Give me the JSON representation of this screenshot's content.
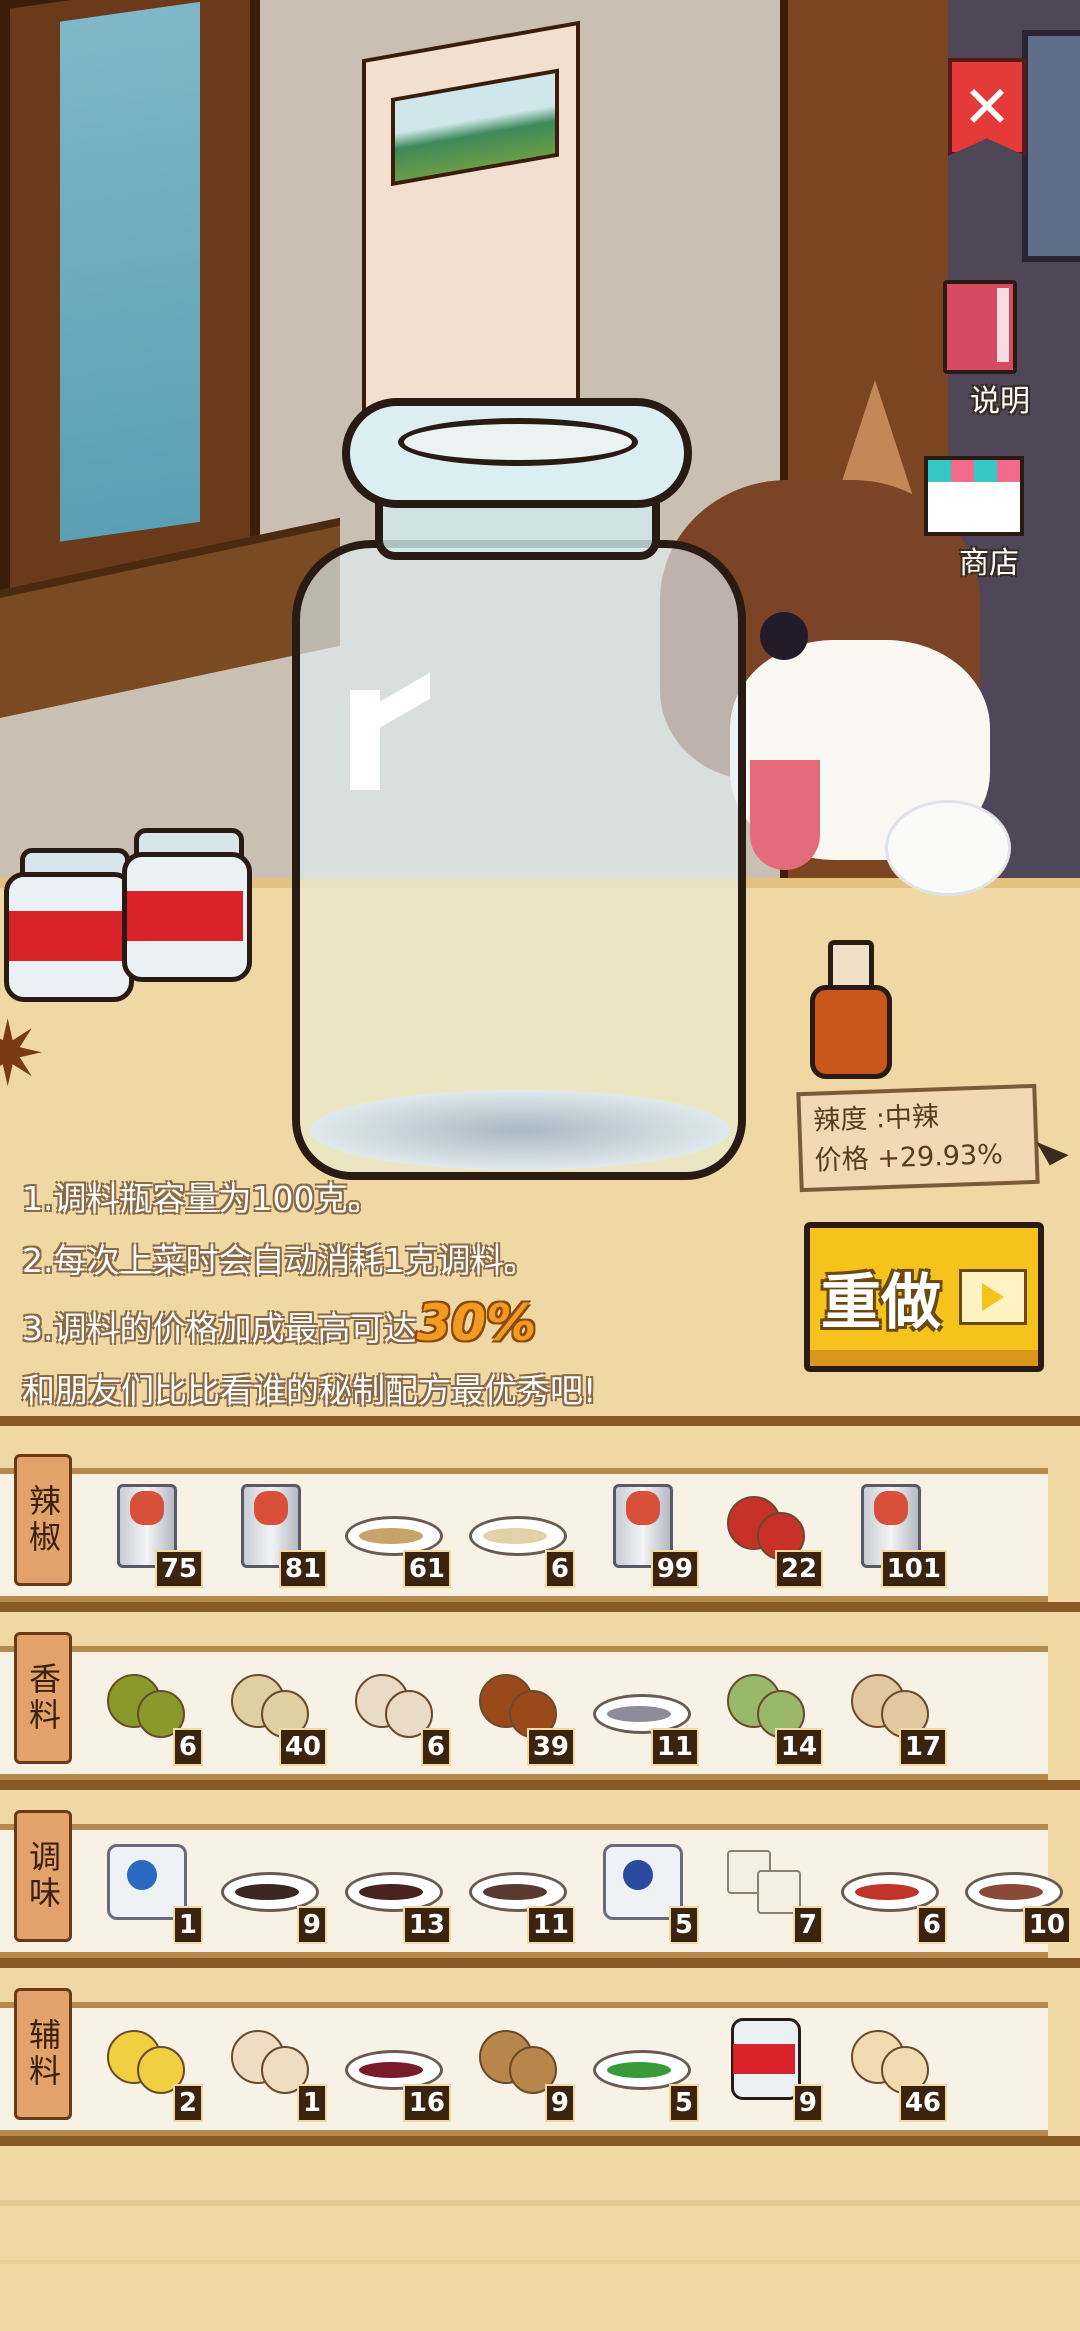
{
  "top_controls": {
    "close_symbol": "✕",
    "help_label": "说明",
    "shop_label": "商店"
  },
  "info_card": {
    "spice_level": "辣度 :中辣",
    "price_bonus": "价格 +29.93%"
  },
  "rules": {
    "line1": "1.调料瓶容量为100克。",
    "line2": "2.每次上菜时会自动消耗1克调料。",
    "line3_prefix": "3.调料的价格加成最高可达",
    "line3_highlight": "30%",
    "line4": "和朋友们比比看谁的秘制配方最优秀吧!"
  },
  "redo_button": {
    "label": "重做"
  },
  "shelves": [
    {
      "label": "辣椒",
      "items": [
        {
          "icon": "red-spice-can-icon",
          "count": "75"
        },
        {
          "icon": "red-spice-can-icon",
          "count": "81"
        },
        {
          "icon": "tan-powder-dish-icon",
          "count": "61"
        },
        {
          "icon": "light-powder-dish-icon",
          "count": "6"
        },
        {
          "icon": "red-spice-can-icon",
          "count": "99"
        },
        {
          "icon": "sichuan-pepper-icon",
          "count": "22"
        },
        {
          "icon": "red-spice-can-icon",
          "count": "101"
        }
      ]
    },
    {
      "label": "香料",
      "items": [
        {
          "icon": "green-pods-icon",
          "count": "6"
        },
        {
          "icon": "powder-pile-icon",
          "count": "40"
        },
        {
          "icon": "garlic-icon",
          "count": "6"
        },
        {
          "icon": "star-anise-cinnamon-icon",
          "count": "39"
        },
        {
          "icon": "grey-powder-dish-icon",
          "count": "11"
        },
        {
          "icon": "cardamom-icon",
          "count": "14"
        },
        {
          "icon": "nutmeg-icon",
          "count": "17"
        }
      ]
    },
    {
      "label": "调味",
      "items": [
        {
          "icon": "salt-bag-icon",
          "count": "1"
        },
        {
          "icon": "dark-sauce-dish-icon",
          "count": "9"
        },
        {
          "icon": "soy-sauce-dish-icon",
          "count": "13"
        },
        {
          "icon": "oyster-sauce-dish-icon",
          "count": "11"
        },
        {
          "icon": "msg-bag-icon",
          "count": "5"
        },
        {
          "icon": "sugar-cubes-icon",
          "count": "7"
        },
        {
          "icon": "red-sauce-dish-icon",
          "count": "6"
        },
        {
          "icon": "vinegar-dish-icon",
          "count": "10"
        }
      ]
    },
    {
      "label": "辅料",
      "items": [
        {
          "icon": "lemon-slice-icon",
          "count": "2"
        },
        {
          "icon": "peanuts-icon",
          "count": "1"
        },
        {
          "icon": "berries-dish-icon",
          "count": "16"
        },
        {
          "icon": "walnut-icon",
          "count": "9"
        },
        {
          "icon": "scallion-dish-icon",
          "count": "5"
        },
        {
          "icon": "tomato-jar-icon",
          "count": "9"
        },
        {
          "icon": "cashew-icon",
          "count": "46"
        }
      ]
    }
  ],
  "colors": {
    "accent_yellow": "#f6c31c",
    "close_red": "#e43a3a",
    "highlight_orange": "#f39a22",
    "shelf_wood": "#8a5a26"
  }
}
